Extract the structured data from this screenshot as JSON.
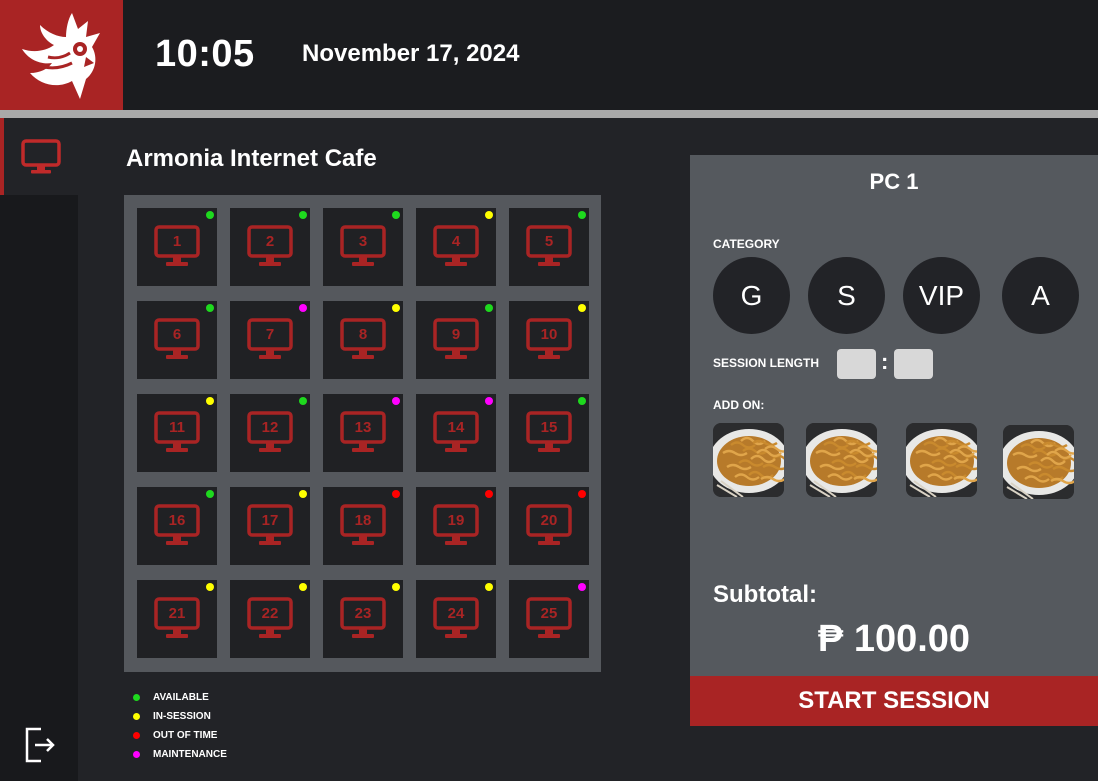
{
  "header": {
    "time": "10:05",
    "date": "November 17, 2024"
  },
  "cafe": {
    "title": "Armonia Internet Cafe"
  },
  "status_colors": {
    "available": "#1ed91e",
    "in-session": "#ffff00",
    "out-of-time": "#ff0000",
    "maintenance": "#ff00ff"
  },
  "pcs": [
    {
      "num": "1",
      "status": "available"
    },
    {
      "num": "2",
      "status": "available"
    },
    {
      "num": "3",
      "status": "available"
    },
    {
      "num": "4",
      "status": "in-session"
    },
    {
      "num": "5",
      "status": "available"
    },
    {
      "num": "6",
      "status": "available"
    },
    {
      "num": "7",
      "status": "maintenance"
    },
    {
      "num": "8",
      "status": "in-session"
    },
    {
      "num": "9",
      "status": "available"
    },
    {
      "num": "10",
      "status": "in-session"
    },
    {
      "num": "11",
      "status": "in-session"
    },
    {
      "num": "12",
      "status": "available"
    },
    {
      "num": "13",
      "status": "maintenance"
    },
    {
      "num": "14",
      "status": "maintenance"
    },
    {
      "num": "15",
      "status": "available"
    },
    {
      "num": "16",
      "status": "available"
    },
    {
      "num": "17",
      "status": "in-session"
    },
    {
      "num": "18",
      "status": "out-of-time"
    },
    {
      "num": "19",
      "status": "out-of-time"
    },
    {
      "num": "20",
      "status": "out-of-time"
    },
    {
      "num": "21",
      "status": "in-session"
    },
    {
      "num": "22",
      "status": "in-session"
    },
    {
      "num": "23",
      "status": "in-session"
    },
    {
      "num": "24",
      "status": "in-session"
    },
    {
      "num": "25",
      "status": "maintenance"
    }
  ],
  "legend": {
    "available": "AVAILABLE",
    "in_session": "IN-SESSION",
    "out_of_time": "OUT OF TIME",
    "maintenance": "MAINTENANCE"
  },
  "panel": {
    "title": "PC 1",
    "category_label": "CATEGORY",
    "categories": [
      "G",
      "S",
      "VIP",
      "A"
    ],
    "session_length_label": "SESSION LENGTH",
    "session_hours": "",
    "session_minutes": "",
    "addon_label": "ADD ON:",
    "addons": [
      "noodles",
      "noodles",
      "noodles",
      "noodles"
    ],
    "subtotal_label": "Subtotal:",
    "subtotal_value": "₱ 100.00",
    "start_label": "START SESSION"
  },
  "icons": {
    "logo": "owl-logo-icon",
    "sidebar_active": "monitor-icon",
    "logout": "logout-icon"
  }
}
